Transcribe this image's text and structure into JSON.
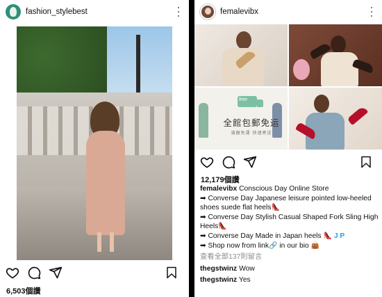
{
  "left_post": {
    "username": "fashion_stylebest",
    "likes": "6,503個讚"
  },
  "right_post": {
    "username": "femalevibx",
    "grid_truck_label": "free",
    "grid_promo_text": "全館包郵免运",
    "grid_promo_subtext": "滿額免運 快速寄送",
    "likes": "12,179個讚",
    "caption": {
      "author": "femalevibx",
      "title": "Conscious Day Online Store",
      "lines": [
        "➡ Converse Day Japanese leisure pointed low-heeled shoes suede flat heels",
        "➡ Converse Day Stylish Casual Shaped Fork Sling High Heels",
        "➡ Converse Day Made in Japan heels",
        "➡ Shop now from link",
        " in our bio"
      ],
      "heel_emoji": "👠",
      "jp_badge": "J P",
      "link_emoji": "🔗",
      "bag_emoji": "👜"
    },
    "view_all_comments": "查看全部137則留言",
    "comments": [
      {
        "user": "thegstwinz",
        "text": "Wow"
      },
      {
        "user": "thegstwinz",
        "text": "Yes"
      }
    ]
  },
  "icons": [
    "like-icon",
    "comment-icon",
    "share-icon",
    "save-icon",
    "more-options-icon"
  ]
}
